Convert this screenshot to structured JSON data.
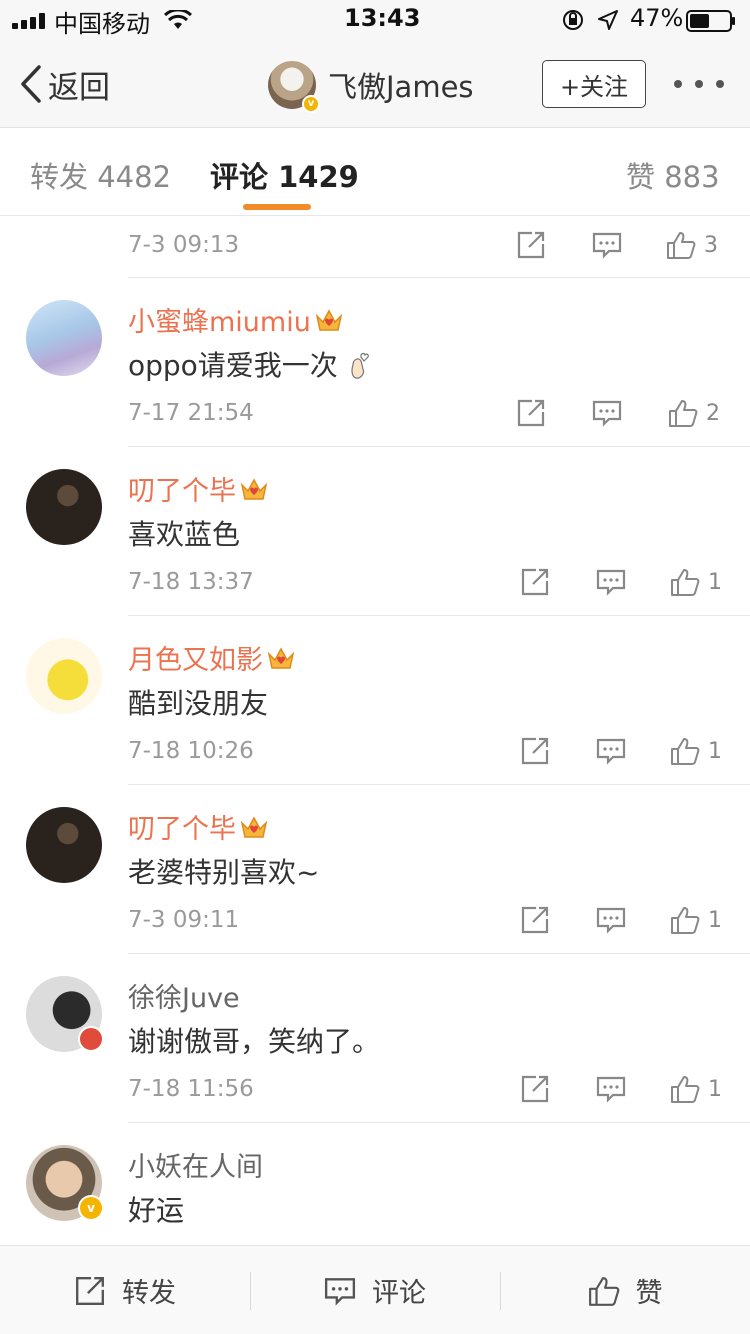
{
  "status_bar": {
    "carrier": "中国移动",
    "time": "13:43",
    "battery": "47%"
  },
  "nav": {
    "back_label": "返回",
    "username": "飞傲James",
    "follow_label": "+关注"
  },
  "tabs": {
    "repost": "转发 4482",
    "comment": "评论 1429",
    "like": "赞 883"
  },
  "partial_row": {
    "time": "7-3 09:13",
    "likes": "3"
  },
  "comments": [
    {
      "name": "小蜜蜂miumiu",
      "text": "oppo请爱我一次",
      "time": "7-17 21:54",
      "likes": "2"
    },
    {
      "name": "叨了个毕",
      "text": "喜欢蓝色",
      "time": "7-18 13:37",
      "likes": "1"
    },
    {
      "name": "月色又如影",
      "text": "酷到没朋友",
      "time": "7-18 10:26",
      "likes": "1"
    },
    {
      "name": "叨了个毕",
      "text": "老婆特别喜欢~",
      "time": "7-3 09:11",
      "likes": "1"
    },
    {
      "name": "徐徐Juve",
      "text": "谢谢傲哥，笑纳了。",
      "time": "7-18 11:56",
      "likes": "1"
    },
    {
      "name": "小妖在人间",
      "text": "好运"
    }
  ],
  "toolbar": {
    "repost": "转发",
    "comment": "评论",
    "like": "赞"
  },
  "colors": {
    "accent": "#f28c28",
    "vip_name": "#eb7350",
    "muted": "#9a9a9a"
  }
}
